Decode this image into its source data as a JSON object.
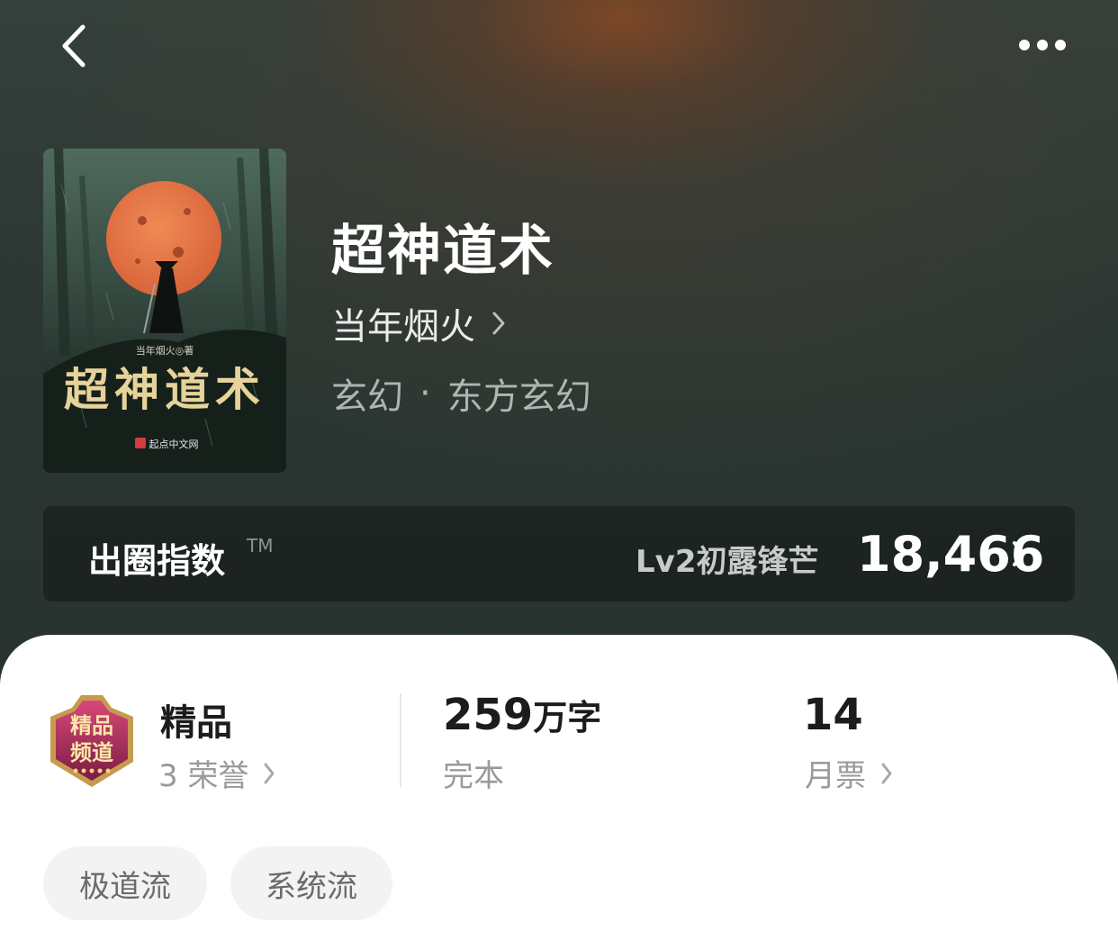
{
  "nav": {
    "back_icon": "chevron-left-icon",
    "more_icon": "more-dots-icon"
  },
  "book": {
    "title": "超神道术",
    "author": "当年烟火",
    "genre_main": "玄幻",
    "genre_separator": "·",
    "genre_sub": "东方玄幻",
    "cover": {
      "author_line": "当年烟火◎著",
      "title_calligraphy": "超神道术",
      "publisher": "起点中文网"
    }
  },
  "index_bar": {
    "label": "出圈指数",
    "trademark": "TM",
    "level": "Lv2初露锋芒",
    "value": "18,466"
  },
  "stats": {
    "badge": {
      "text_top": "精品",
      "text_bottom": "频道",
      "icon": "premium-channel-badge-icon"
    },
    "quality_label": "精品",
    "honors": "3 荣誉",
    "word_count": "259",
    "word_unit": "万字",
    "status": "完本",
    "monthly_votes": "14",
    "monthly_votes_label": "月票"
  },
  "tags": [
    "极道流",
    "系统流"
  ],
  "colors": {
    "hero_bg": "#2c3733",
    "hero_glow": "#804826",
    "panel_bg": "#ffffff",
    "tag_bg": "#f3f3f3",
    "badge_accent": "#b0285a"
  }
}
